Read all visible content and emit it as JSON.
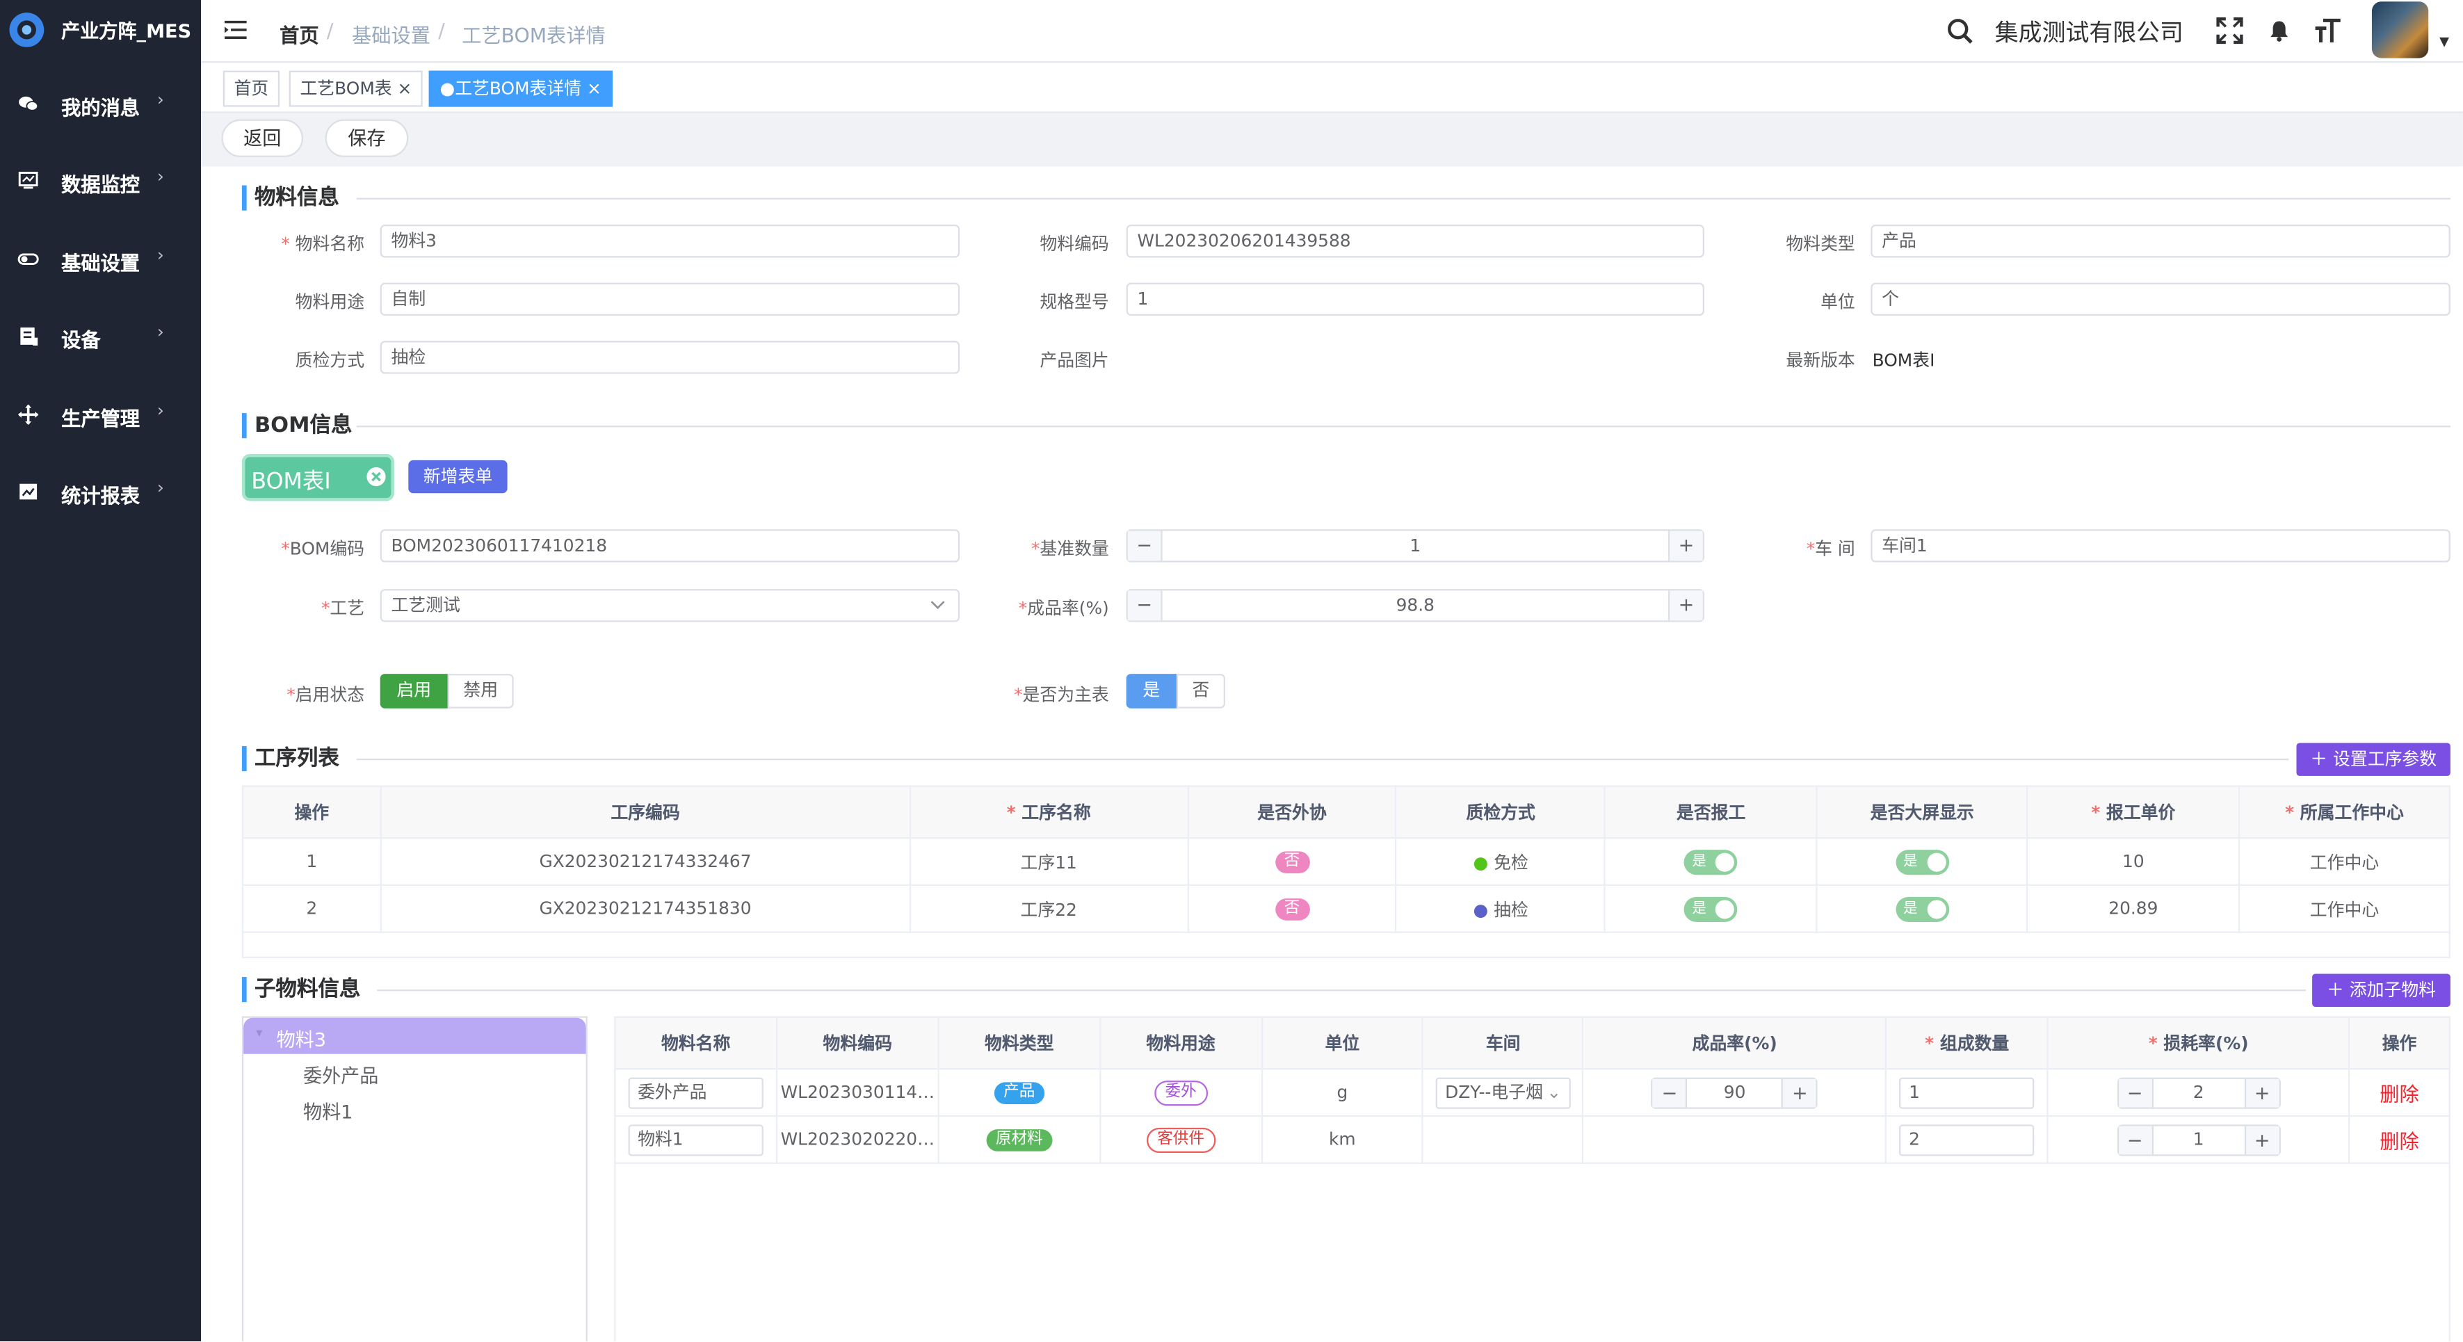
{
  "app": {
    "title": "产业方阵_MES"
  },
  "sidebar": {
    "items": [
      {
        "label": "我的消息",
        "icon": "chat-icon"
      },
      {
        "label": "数据监控",
        "icon": "monitor-icon"
      },
      {
        "label": "基础设置",
        "icon": "toggle-icon"
      },
      {
        "label": "设备",
        "icon": "device-icon"
      },
      {
        "label": "生产管理",
        "icon": "move-icon"
      },
      {
        "label": "统计报表",
        "icon": "report-icon"
      }
    ]
  },
  "header": {
    "breadcrumb": [
      "首页",
      "基础设置",
      "工艺BOM表详情"
    ],
    "company": "集成测试有限公司"
  },
  "tags": [
    {
      "label": "首页"
    },
    {
      "label": "工艺BOM表"
    },
    {
      "label": "工艺BOM表详情"
    }
  ],
  "actions": {
    "back": "返回",
    "save": "保存"
  },
  "material": {
    "title": "物料信息",
    "name_label": "物料名称",
    "name": "物料3",
    "code_label": "物料编码",
    "code": "WL20230206201439588",
    "type_label": "物料类型",
    "type": "产品",
    "use_label": "物料用途",
    "use": "自制",
    "spec_label": "规格型号",
    "spec": "1",
    "unit_label": "单位",
    "unit": "个",
    "qc_label": "质检方式",
    "qc": "抽检",
    "image_label": "产品图片",
    "version_label": "最新版本",
    "version": "BOM表I"
  },
  "bom": {
    "title": "BOM信息",
    "tab": "BOM表I",
    "new_form": "新增表单",
    "code_label": "BOM编码",
    "code": "BOM2023060117410218",
    "base_label": "基准数量",
    "base_qty": "1",
    "workshop_label": "车 间",
    "workshop": "车间1",
    "process_label": "工艺",
    "process": "工艺测试",
    "yield_label": "成品率(%)",
    "yield": "98.8",
    "status_label": "启用状态",
    "enable": "启用",
    "disable": "禁用",
    "main_label": "是否为主表",
    "yes": "是",
    "no": "否"
  },
  "procedures": {
    "title": "工序列表",
    "setup": "设置工序参数",
    "headers": [
      "操作",
      "工序编码",
      "工序名称",
      "是否外协",
      "质检方式",
      "是否报工",
      "是否大屏显示",
      "报工单价",
      "所属工作中心"
    ],
    "rows": [
      {
        "op": "1",
        "code": "GX20230212174332467",
        "name": "工序11",
        "outsource": "否",
        "qc": "免检",
        "report": "是",
        "screen": "是",
        "price": "10",
        "center": "工作中心"
      },
      {
        "op": "2",
        "code": "GX20230212174351830",
        "name": "工序22",
        "outsource": "否",
        "qc": "抽检",
        "report": "是",
        "screen": "是",
        "price": "20.89",
        "center": "工作中心"
      }
    ]
  },
  "submaterial": {
    "title": "子物料信息",
    "add": "添加子物料",
    "tree": {
      "root": "物料3",
      "children": [
        "委外产品",
        "物料1"
      ]
    },
    "headers": [
      "物料名称",
      "物料编码",
      "物料类型",
      "物料用途",
      "单位",
      "车间",
      "成品率(%)",
      "组成数量",
      "损耗率(%)",
      "操作"
    ],
    "rows": [
      {
        "name": "委外产品",
        "code": "WL2023030114…",
        "type": "产品",
        "use": "委外",
        "unit": "g",
        "workshop": "DZY--电子烟",
        "yield": "90",
        "qty": "1",
        "loss": "2",
        "op": "删除"
      },
      {
        "name": "物料1",
        "code": "WL2023020220…",
        "type": "原材料",
        "use": "客供件",
        "unit": "km",
        "workshop": "",
        "yield": "",
        "qty": "2",
        "loss": "1",
        "op": "删除"
      }
    ]
  }
}
